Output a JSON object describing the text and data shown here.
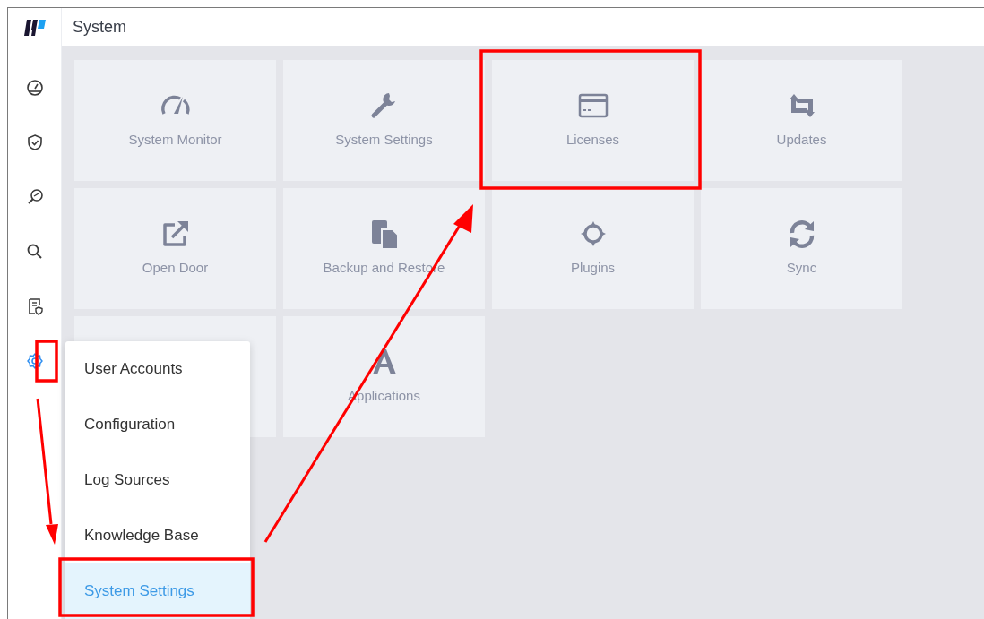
{
  "header": {
    "title": "System"
  },
  "sidebar": {
    "items": [
      {
        "kind": "gauge",
        "selected": false
      },
      {
        "kind": "shield",
        "selected": false
      },
      {
        "kind": "zoom",
        "selected": false
      },
      {
        "kind": "search",
        "selected": false
      },
      {
        "kind": "report",
        "selected": false
      },
      {
        "kind": "gear",
        "selected": true
      }
    ]
  },
  "tiles": [
    {
      "kind": "speedometer",
      "label": "System Monitor"
    },
    {
      "kind": "wrench",
      "label": "System Settings"
    },
    {
      "kind": "card",
      "label": "Licenses"
    },
    {
      "kind": "retweet",
      "label": "Updates"
    },
    {
      "kind": "external",
      "label": "Open Door"
    },
    {
      "kind": "files",
      "label": "Backup and Restore"
    },
    {
      "kind": "crosshair",
      "label": "Plugins"
    },
    {
      "kind": "refresh",
      "label": "Sync"
    },
    {
      "kind": "covered"
    },
    {
      "kind": "letter",
      "label": "Applications"
    }
  ],
  "menu": {
    "items": [
      {
        "label": "User Accounts",
        "selected": false
      },
      {
        "label": "Configuration",
        "selected": false
      },
      {
        "label": "Log Sources",
        "selected": false
      },
      {
        "label": "Knowledge Base",
        "selected": false
      },
      {
        "label": "System Settings",
        "selected": true
      }
    ]
  }
}
